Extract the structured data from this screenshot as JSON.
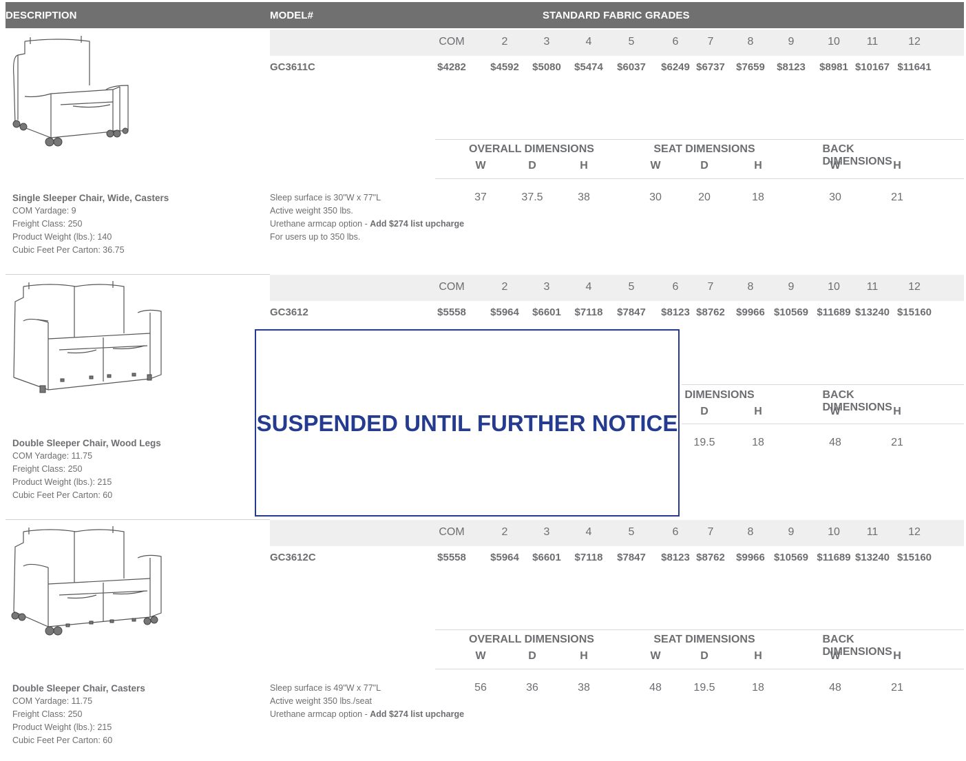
{
  "header": {
    "description": "DESCRIPTION",
    "model": "MODEL#",
    "grades": "STANDARD FABRIC GRADES"
  },
  "grade_labels": [
    "COM",
    "2",
    "3",
    "4",
    "5",
    "6",
    "7",
    "8",
    "9",
    "10",
    "11",
    "12"
  ],
  "dim_labels": {
    "overall": "OVERALL DIMENSIONS",
    "seat": "SEAT DIMENSIONS",
    "back": "BACK DIMENSIONS",
    "seat_partial": "DIMENSIONS",
    "w": "W",
    "d": "D",
    "h": "H"
  },
  "products": [
    {
      "model": "GC3611C",
      "prices": [
        "$4282",
        "$4592",
        "$5080",
        "$5474",
        "$6037",
        "$6249",
        "$6737",
        "$7659",
        "$8123",
        "$8981",
        "$10167",
        "$11641"
      ],
      "dims": [
        "37",
        "37.5",
        "38",
        "30",
        "20",
        "18",
        "30",
        "21"
      ],
      "title": "Single Sleeper Chair, Wide, Casters",
      "details": [
        "COM Yardage: 9",
        "Freight Class: 250",
        "Product Weight (lbs.): 140",
        "Cubic Feet Per Carton: 36.75"
      ],
      "notes": [
        "Sleep surface is 30\"W x 77\"L",
        "Active weight 350 lbs.",
        "Urethane armcap option - ",
        "For users up to 350 lbs."
      ],
      "upcharge": "Add $274 list upcharge"
    },
    {
      "model": "GC3612",
      "prices": [
        "$5558",
        "$5964",
        "$6601",
        "$7118",
        "$7847",
        "$8123",
        "$8762",
        "$9966",
        "$10569",
        "$11689",
        "$13240",
        "$15160"
      ],
      "dims_visible": [
        "19.5",
        "18",
        "48",
        "21"
      ],
      "title": "Double Sleeper Chair, Wood Legs",
      "details": [
        "COM Yardage: 11.75",
        "Freight Class: 250",
        "Product Weight (lbs.): 215",
        "Cubic Feet Per Carton: 60"
      ],
      "overlay": "SUSPENDED UNTIL FURTHER NOTICE"
    },
    {
      "model": "GC3612C",
      "prices": [
        "$5558",
        "$5964",
        "$6601",
        "$7118",
        "$7847",
        "$8123",
        "$8762",
        "$9966",
        "$10569",
        "$11689",
        "$13240",
        "$15160"
      ],
      "dims": [
        "56",
        "36",
        "38",
        "48",
        "19.5",
        "18",
        "48",
        "21"
      ],
      "title": "Double Sleeper Chair, Casters",
      "details": [
        "COM Yardage: 11.75",
        "Freight Class: 250",
        "Product Weight (lbs.): 215",
        "Cubic Feet Per Carton: 60"
      ],
      "notes": [
        "Sleep surface is 49\"W x 77\"L",
        "Active weight 350 lbs./seat",
        "Urethane armcap option - "
      ],
      "upcharge": "Add $274 list upcharge"
    }
  ]
}
